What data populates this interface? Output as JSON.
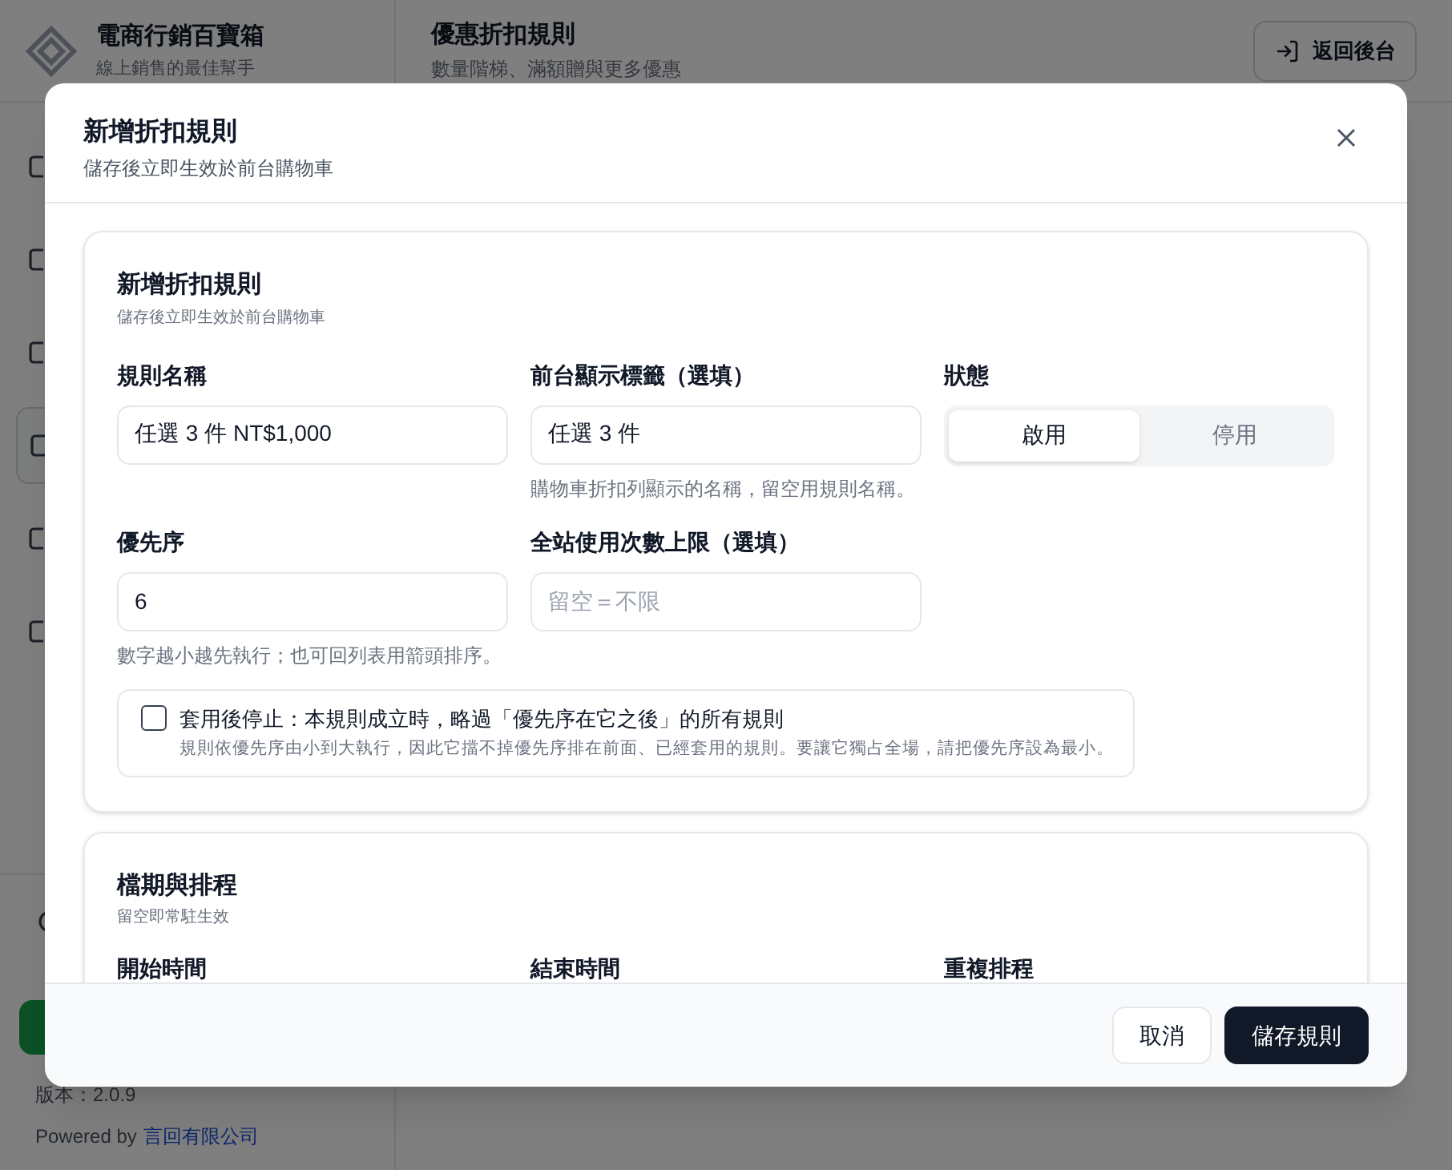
{
  "app": {
    "name": "電商行銷百寶箱",
    "tagline": "線上銷售的最佳幫手",
    "version": "版本：2.0.9",
    "powered_by": "Powered by",
    "company": "言回有限公司"
  },
  "header": {
    "title": "優惠折扣規則",
    "subtitle": "數量階梯、滿額贈與更多優惠",
    "back_button": "返回後台"
  },
  "sidebar": {
    "items": [
      {
        "selected": false
      },
      {
        "selected": false
      },
      {
        "selected": false
      },
      {
        "selected": true
      },
      {
        "selected": false
      },
      {
        "selected": false
      }
    ]
  },
  "dialog": {
    "title": "新增折扣規則",
    "subtitle": "儲存後立即生效於前台購物車",
    "basic": {
      "title": "新增折扣規則",
      "subtitle": "儲存後立即生效於前台購物車",
      "rule_name": {
        "label": "規則名稱",
        "value": "任選 3 件 NT$1,000"
      },
      "display_label": {
        "label": "前台顯示標籤（選填）",
        "value": "任選 3 件",
        "help": "購物車折扣列顯示的名稱，留空用規則名稱。"
      },
      "status": {
        "label": "狀態",
        "options": [
          {
            "label": "啟用",
            "selected": true
          },
          {
            "label": "停用",
            "selected": false
          }
        ]
      },
      "priority": {
        "label": "優先序",
        "value": "6",
        "help": "數字越小越先執行；也可回列表用箭頭排序。"
      },
      "usage_limit": {
        "label": "全站使用次數上限（選填）",
        "placeholder": "留空＝不限"
      },
      "stop_after": {
        "label": "套用後停止：本規則成立時，略過「優先序在它之後」的所有規則",
        "description": "規則依優先序由小到大執行，因此它擋不掉優先序排在前面、已經套用的規則。要讓它獨占全場，請把優先序設為最小。",
        "checked": false
      }
    },
    "schedule": {
      "title": "檔期與排程",
      "subtitle": "留空即常駐生效",
      "fields": [
        "開始時間",
        "結束時間",
        "重複排程"
      ]
    },
    "footer": {
      "cancel": "取消",
      "save": "儲存規則"
    }
  }
}
